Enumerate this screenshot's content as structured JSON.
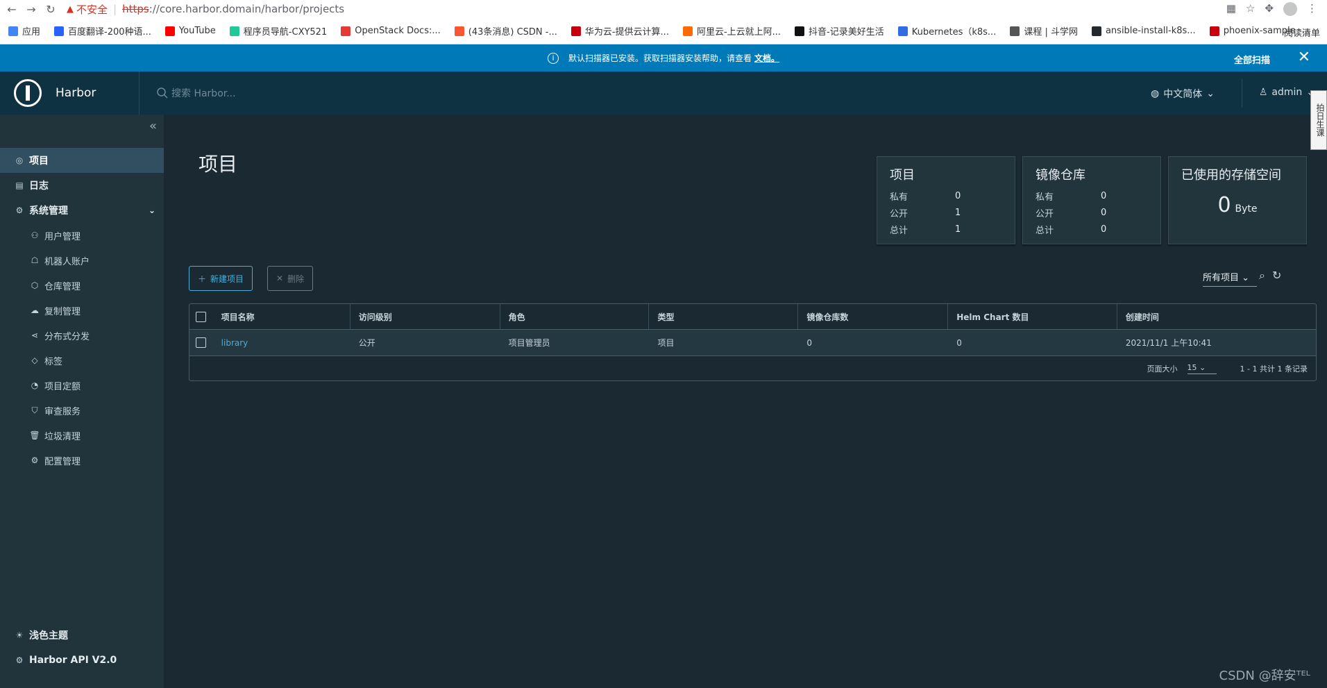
{
  "browser": {
    "insecure_label": "不安全",
    "url_scheme": "https",
    "url_rest": "://core.harbor.domain/harbor/projects",
    "bookmarks": [
      {
        "label": "应用",
        "color": "#4285f4"
      },
      {
        "label": "百度翻译-200种语...",
        "color": "#2962ff"
      },
      {
        "label": "YouTube",
        "color": "#ff0000"
      },
      {
        "label": "程序员导航-CXY521",
        "color": "#20c997"
      },
      {
        "label": "OpenStack Docs:...",
        "color": "#e53935"
      },
      {
        "label": "(43条消息) CSDN -...",
        "color": "#fc5531"
      },
      {
        "label": "华为云-提供云计算...",
        "color": "#c7000b"
      },
      {
        "label": "阿里云-上云就上阿...",
        "color": "#ff6a00"
      },
      {
        "label": "抖音-记录美好生活",
        "color": "#111111"
      },
      {
        "label": "Kubernetes（k8s...",
        "color": "#326ce5"
      },
      {
        "label": "课程 | 斗学网",
        "color": "#555555"
      },
      {
        "label": "ansible-install-k8s...",
        "color": "#24292e"
      },
      {
        "label": "phoenix-sample -...",
        "color": "#c7000b"
      }
    ],
    "reading_list": "阅读清单"
  },
  "banner": {
    "text": "默认扫描器已安装。获取扫描器安装帮助，请查看",
    "link": "文档。",
    "action": "全部扫描"
  },
  "header": {
    "brand": "Harbor",
    "search_placeholder": "搜索 Harbor...",
    "language": "中文简体",
    "user": "admin",
    "side_tab": "拍日生课"
  },
  "sidebar": {
    "items": [
      {
        "label": "项目",
        "icon": "◎"
      },
      {
        "label": "日志",
        "icon": "▤"
      },
      {
        "label": "系统管理",
        "icon": "⚙"
      }
    ],
    "sub_items": [
      {
        "label": "用户管理",
        "icon": "⚇"
      },
      {
        "label": "机器人账户",
        "icon": "☖"
      },
      {
        "label": "仓库管理",
        "icon": "⬡"
      },
      {
        "label": "复制管理",
        "icon": "☁"
      },
      {
        "label": "分布式分发",
        "icon": "⋖"
      },
      {
        "label": "标签",
        "icon": "◇"
      },
      {
        "label": "项目定额",
        "icon": "◔"
      },
      {
        "label": "审查服务",
        "icon": "⛉"
      },
      {
        "label": "垃圾清理",
        "icon": "🗑"
      },
      {
        "label": "配置管理",
        "icon": "⚙"
      }
    ],
    "bottom": [
      {
        "label": "浅色主题",
        "icon": "☀"
      },
      {
        "label": "Harbor API V2.0",
        "icon": "⚙"
      }
    ]
  },
  "main": {
    "title": "项目",
    "cards": {
      "projects": {
        "title": "项目",
        "rows": [
          {
            "k": "私有",
            "v": "0"
          },
          {
            "k": "公开",
            "v": "1"
          },
          {
            "k": "总计",
            "v": "1"
          }
        ]
      },
      "repos": {
        "title": "镜像仓库",
        "rows": [
          {
            "k": "私有",
            "v": "0"
          },
          {
            "k": "公开",
            "v": "0"
          },
          {
            "k": "总计",
            "v": "0"
          }
        ]
      },
      "storage": {
        "title": "已使用的存储空间",
        "value": "0",
        "unit": "Byte"
      }
    },
    "new_project": "新建项目",
    "delete": "删除",
    "filter": "所有项目",
    "columns": [
      "项目名称",
      "访问级别",
      "角色",
      "类型",
      "镜像仓库数",
      "Helm Chart 数目",
      "创建时间"
    ],
    "rows": [
      [
        "library",
        "公开",
        "项目管理员",
        "项目",
        "0",
        "0",
        "2021/11/1 上午10:41"
      ]
    ],
    "page_size_label": "页面大小",
    "page_size": "15",
    "summary": "1 - 1 共计 1 条记录"
  },
  "watermark": "CSDN @辞安ᵀᴱᴸ"
}
